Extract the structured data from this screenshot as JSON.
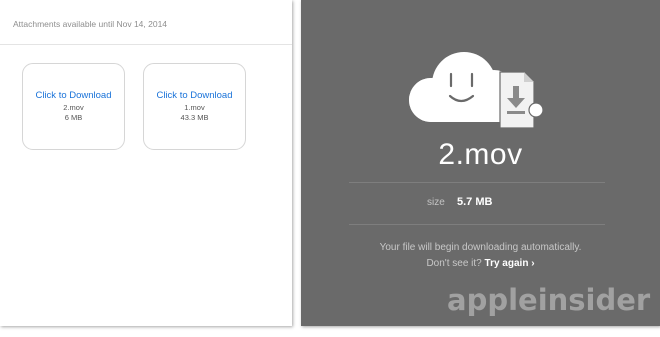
{
  "email": {
    "availability_text": "Attachments available until Nov 14, 2014",
    "attachments": [
      {
        "link_label": "Click to Download",
        "filename": "2.mov",
        "size": "6 MB"
      },
      {
        "link_label": "Click to Download",
        "filename": "1.mov",
        "size": "43.3 MB"
      }
    ]
  },
  "download_page": {
    "file_name": "2.mov",
    "size_label": "size",
    "size_value": "5.7 MB",
    "message": "Your file will begin downloading automatically.",
    "dont_see_text": "Don't see it?",
    "try_again_label": "Try again",
    "try_again_chevron": "›",
    "icon": "cloud-face-icon"
  },
  "watermark": "appleinsider"
}
